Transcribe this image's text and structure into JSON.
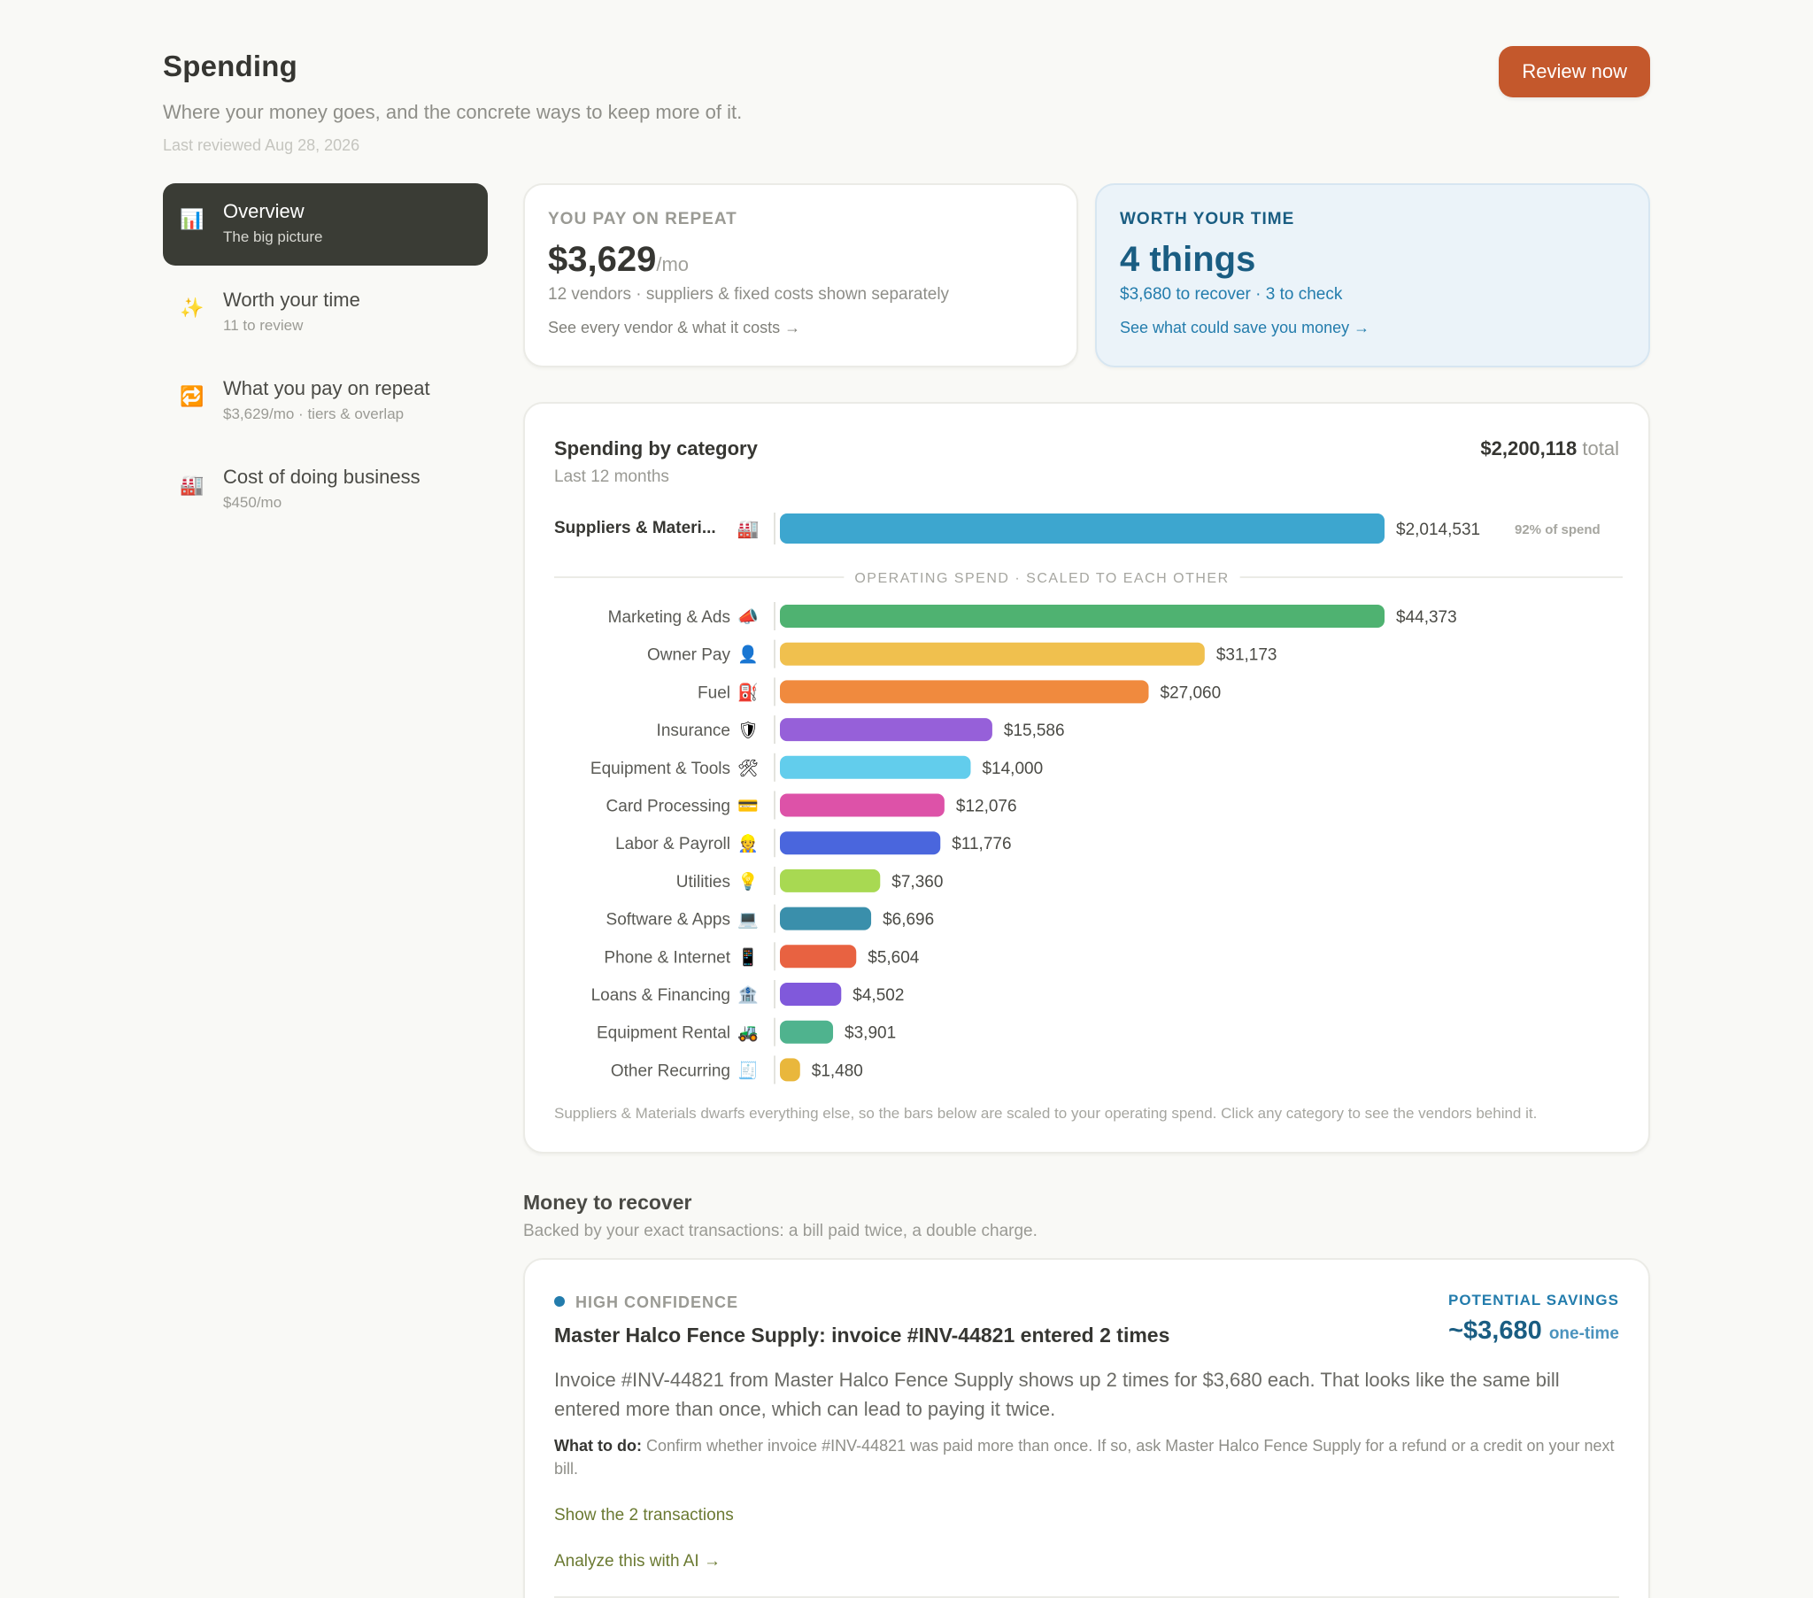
{
  "header": {
    "title": "Spending",
    "subtitle": "Where your money goes, and the concrete ways to keep more of it.",
    "last_reviewed": "Last reviewed Aug 28, 2026",
    "review_button": "Review now"
  },
  "sidebar": {
    "items": [
      {
        "title": "Overview",
        "sub": "The big picture",
        "icon": "📊",
        "active": true
      },
      {
        "title": "Worth your time",
        "sub": "11 to review",
        "icon": "✨",
        "active": false
      },
      {
        "title": "What you pay on repeat",
        "sub": "$3,629/mo · tiers & overlap",
        "icon": "🔁",
        "active": false
      },
      {
        "title": "Cost of doing business",
        "sub": "$450/mo",
        "icon": "🏭",
        "active": false
      }
    ]
  },
  "repeat_card": {
    "eyebrow": "YOU PAY ON REPEAT",
    "value": "$3,629",
    "unit": "/mo",
    "line2": "12 vendors · suppliers & fixed costs shown separately",
    "link": "See every vendor & what it costs →"
  },
  "worth_card": {
    "eyebrow": "WORTH YOUR TIME",
    "value": "4 things",
    "line2": "$3,680 to recover · 3 to check",
    "link": "See what could save you money →"
  },
  "category_card": {
    "title": "Spending by category",
    "subtitle": "Last 12 months",
    "total": "$2,200,118",
    "total_word": "total",
    "footnote": "Suppliers & Materials dwarfs everything else, so the bars below are scaled to your operating spend. Click any category to see the vendors behind it."
  },
  "chart_data": {
    "type": "bar",
    "orientation": "horizontal",
    "top": {
      "category": "Suppliers & Materi...",
      "icon": "🏭",
      "value": 2014531,
      "value_label": "$2,014,531",
      "share": "92% of spend",
      "color": "#3da6cf"
    },
    "divider_label": "OPERATING SPEND · SCALED TO EACH OTHER",
    "categories": [
      "Marketing & Ads",
      "Owner Pay",
      "Fuel",
      "Insurance",
      "Equipment & Tools",
      "Card Processing",
      "Labor & Payroll",
      "Utilities",
      "Software & Apps",
      "Phone & Internet",
      "Loans & Financing",
      "Equipment Rental",
      "Other Recurring"
    ],
    "icons": [
      "📣",
      "👤",
      "⛽",
      "🛡",
      "🛠",
      "💳",
      "👷",
      "💡",
      "💻",
      "📱",
      "🏦",
      "🚜",
      "🧾"
    ],
    "values": [
      44373,
      31173,
      27060,
      15586,
      14000,
      12076,
      11776,
      7360,
      6696,
      5604,
      4502,
      3901,
      1480
    ],
    "value_labels": [
      "$44,373",
      "$31,173",
      "$27,060",
      "$15,586",
      "$14,000",
      "$12,076",
      "$11,776",
      "$7,360",
      "$6,696",
      "$5,604",
      "$4,502",
      "$3,901",
      "$1,480"
    ],
    "colors": [
      "#4fb271",
      "#f0c04e",
      "#f08a3e",
      "#9660d9",
      "#62cdec",
      "#dd52a8",
      "#4a66dd",
      "#a8d952",
      "#3a8fab",
      "#e86241",
      "#8059db",
      "#4fb38e",
      "#e9b73c"
    ]
  },
  "recover": {
    "title": "Money to recover",
    "subtitle": "Backed by your exact transactions: a bill paid twice, a double charge."
  },
  "finding": {
    "confidence": "HIGH CONFIDENCE",
    "title": "Master Halco Fence Supply: invoice #INV-44821 entered 2 times",
    "savings_label": "POTENTIAL SAVINGS",
    "savings_amount": "~$3,680",
    "savings_term": "one-time",
    "body": "Invoice #INV-44821 from Master Halco Fence Supply shows up 2 times for $3,680 each. That looks like the same bill entered more than once, which can lead to paying it twice.",
    "todo_label": "What to do:",
    "todo_text": "Confirm whether invoice #INV-44821 was paid more than once. If so, ask Master Halco Fence Supply for a refund or a credit on your next bill.",
    "show_link": "Show the 2 transactions",
    "ai_link": "Analyze this with AI →"
  }
}
